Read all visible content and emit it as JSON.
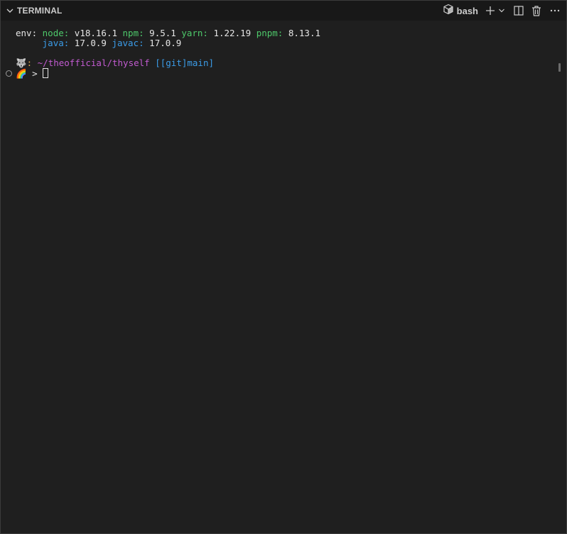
{
  "header": {
    "title": "TERMINAL",
    "shell_label": "bash",
    "icons": [
      "chevron-down-icon",
      "shell-cube-icon",
      "plus-icon",
      "chevron-down-icon",
      "split-icon",
      "trash-icon",
      "more-icon"
    ]
  },
  "terminal": {
    "env_line": {
      "prefix": "env: ",
      "node_key": "node: ",
      "node_val": "v18.16.1 ",
      "npm_key": "npm: ",
      "npm_val": "9.5.1 ",
      "yarn_key": "yarn: ",
      "yarn_val": "1.22.19 ",
      "pnpm_key": "pnpm: ",
      "pnpm_val": "8.13.1"
    },
    "java_line": {
      "indent": "     ",
      "java_key": "java: ",
      "java_val": "17.0.9 ",
      "javac_key": "javac: ",
      "javac_val": "17.0.9"
    },
    "prompt_line": {
      "emoji": "🐺",
      "colon": ": ",
      "path": "~/theofficial/thyself",
      "git": " [[git]main]"
    },
    "input_line": {
      "emoji": "🌈",
      "chevron": " > "
    }
  },
  "colors": {
    "key_green": "#4ec96b",
    "key_blue": "#3b9ce8",
    "path_magenta": "#c25bd1",
    "background": "#1f1f1f"
  }
}
